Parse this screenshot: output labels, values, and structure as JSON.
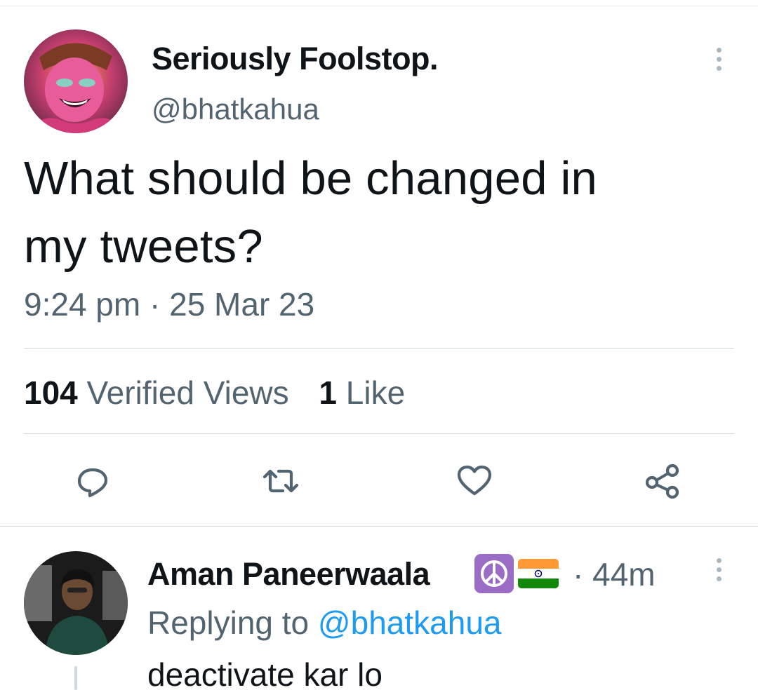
{
  "tweet": {
    "author": {
      "name": "Seriously Foolstop.",
      "handle": "@bhatkahua"
    },
    "text": "What should be changed in\nmy tweets?",
    "time": "9:24 pm",
    "date": "25 Mar 23",
    "separator": "·",
    "stats": {
      "views_count": "104",
      "views_label": "Verified Views",
      "likes_count": "1",
      "likes_label": "Like"
    },
    "actions": [
      "reply",
      "retweet",
      "like",
      "share"
    ]
  },
  "reply": {
    "author": {
      "name": "Aman Paneerwaala",
      "badges": [
        "peace-symbol-emoji",
        "india-flag-emoji"
      ]
    },
    "time_prefix": "·",
    "time": "44m",
    "context_prefix": "Replying to",
    "context_handle": "@bhatkahua",
    "text": "deactivate kar lo"
  },
  "colors": {
    "text_primary": "#0f1419",
    "text_secondary": "#536471",
    "link": "#1d9bf0",
    "divider": "#cfd9de",
    "peace_badge": "#9a6cc5",
    "flag_saffron": "#ff9933",
    "flag_green": "#138808",
    "flag_chakra": "#000080"
  }
}
